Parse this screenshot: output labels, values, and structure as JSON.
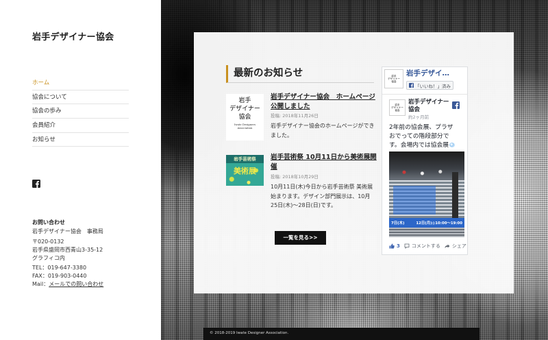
{
  "colors": {
    "accent": "#c9911f",
    "facebook_blue": "#3b5998",
    "button_bg": "#111111",
    "footer_bg": "#111111"
  },
  "site": {
    "title": "岩手デザイナー協会"
  },
  "nav": {
    "items": [
      {
        "label": "ホーム",
        "active": true
      },
      {
        "label": "協会について",
        "active": false
      },
      {
        "label": "協会の歩み",
        "active": false
      },
      {
        "label": "会員紹介",
        "active": false
      },
      {
        "label": "お知らせ",
        "active": false
      }
    ]
  },
  "social": {
    "icon": "facebook-icon"
  },
  "contact": {
    "heading": "お問い合わせ",
    "office": "岩手デザイナー協会　事務局",
    "postal_code": "〒020-0132",
    "address": "岩手県盛岡市西青山3-35-12",
    "building": "グラフィコ内",
    "tel": "TEL：019-647-3380",
    "fax": "FAX：019-903-0440",
    "mail_label": "Mail：",
    "mail_link": "メールでの問い合わせ"
  },
  "news": {
    "heading": "最新のお知らせ",
    "items": [
      {
        "title": "岩手デザイナー協会　ホームページ公開しました",
        "date": "投稿: 2018年11月26日",
        "excerpt": "岩手デザイナー協会のホームページができました。",
        "thumbnail": {
          "lines": [
            "岩手",
            "デザイナー",
            "協会"
          ],
          "subtitle": "Iwate Designers Association"
        }
      },
      {
        "title": "岩手芸術祭 10月11日から美術展開催",
        "date": "投稿: 2018年10月29日",
        "excerpt": "10月11日(木)今日から岩手芸術祭 美術展始まります。デザイン部門展示は、10月25日(木)〜28日(日)です。",
        "thumbnail": {
          "lines": [
            "岩手芸術祭",
            "美術展"
          ]
        }
      }
    ],
    "more_button": "一覧を見る>>"
  },
  "facebook_widget": {
    "page_name": "岩手デザイ…",
    "liked_button": "「いいね！」済み",
    "post": {
      "author": "岩手デザイナー協会",
      "time": "約2ヶ月前",
      "text": "2年前の協会展、プラザおでっての階段部分です。会場内では協会展",
      "image_caption": [
        "7日(木)",
        "12日(月)◎10:00〜19:00"
      ],
      "like_count": "3",
      "comment_label": "コメントする",
      "share_label": "シェア"
    }
  },
  "footer": {
    "copyright": "© 2018-2019 Iwate Designer Association."
  }
}
